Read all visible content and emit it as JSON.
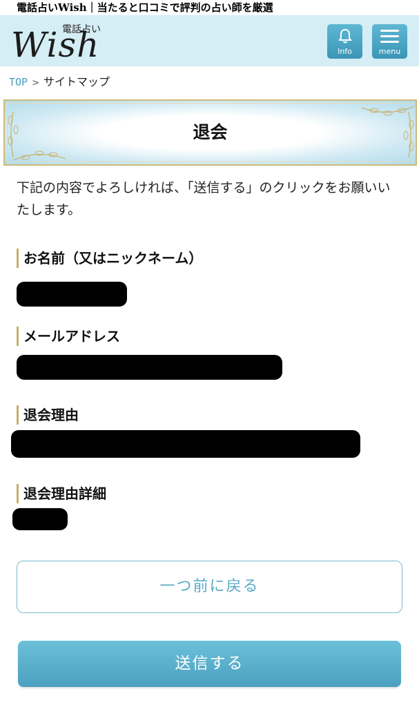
{
  "page_title": "電話占いWish｜当たると口コミで評判の占い師を厳選",
  "header": {
    "logo_small": "電話占い",
    "logo_main": "Wish",
    "info_label": "Info",
    "menu_label": "menu"
  },
  "breadcrumb": {
    "top": "TOP",
    "separator": ">",
    "current": "サイトマップ"
  },
  "banner": {
    "title": "退会"
  },
  "intro": "下記の内容でよろしければ、「送信する」のクリックをお願いいたします。",
  "fields": [
    {
      "label": "お名前（又はニックネーム）",
      "value": "redacted"
    },
    {
      "label": "メールアドレス",
      "value": "redacted"
    },
    {
      "label": "退会理由",
      "value": "redacted"
    },
    {
      "label": "退会理由詳細",
      "value": "redacted"
    }
  ],
  "buttons": {
    "back": "一つ前に戻る",
    "submit": "送信する"
  },
  "colors": {
    "header_bg": "#d5edf5",
    "accent": "#4aa0bf",
    "gold": "#c7ae6a"
  }
}
